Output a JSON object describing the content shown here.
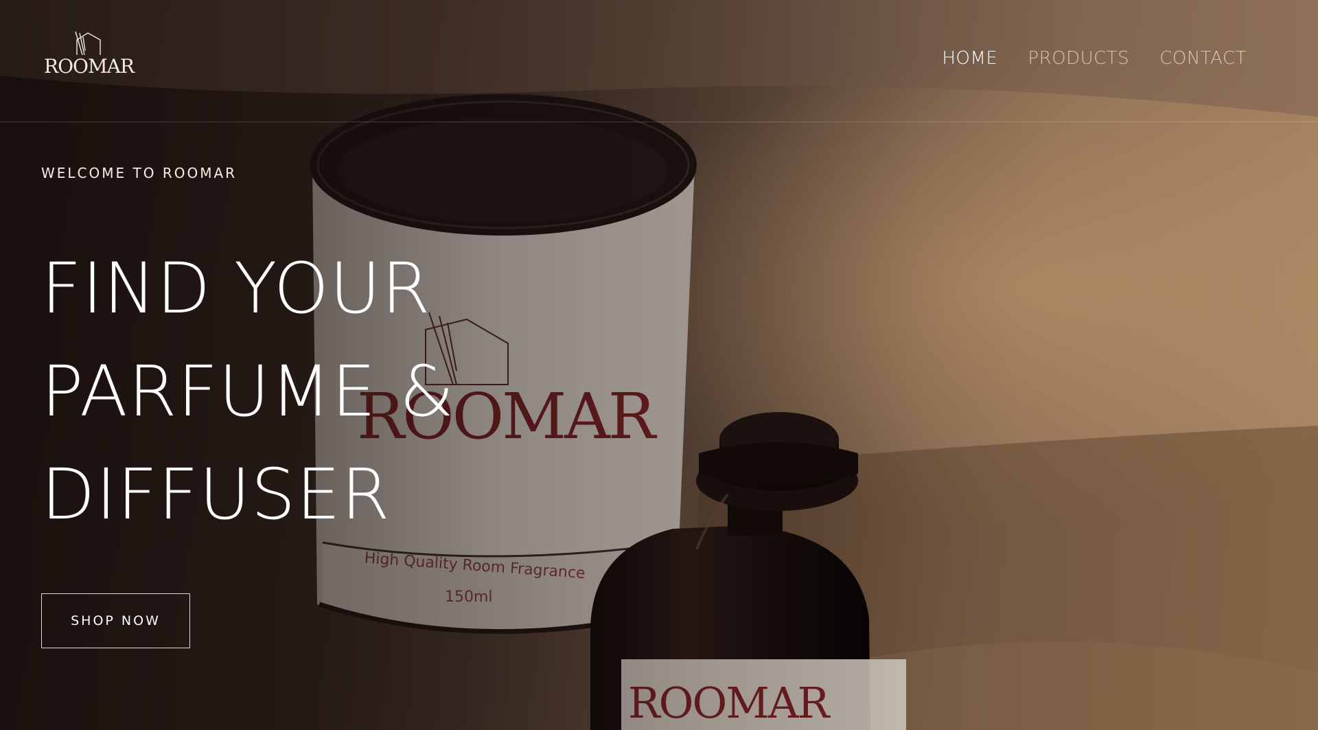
{
  "brand": {
    "name": "ROOMAR",
    "logo_icon": "house-with-reeds-icon"
  },
  "nav": {
    "items": [
      {
        "label": "HOME",
        "active": true
      },
      {
        "label": "PRODUCTS",
        "active": false
      },
      {
        "label": "CONTACT",
        "active": false
      }
    ]
  },
  "hero": {
    "eyebrow": "WELCOME TO ROOMAR",
    "headline_lines": [
      "FIND YOUR",
      "PARFUME &",
      "DIFFUSER"
    ],
    "cta_label": "SHOP NOW"
  },
  "product_image": {
    "box_brand": "ROOMAR",
    "box_caption": "High Quality Room Fragrance",
    "box_volume": "150ml",
    "bottle_brand": "ROOMAR"
  },
  "colors": {
    "text": "#ffffff",
    "nav_inactive": "#c9c0b6",
    "background_dark": "#241713",
    "background_warm": "#a88563",
    "brand_accent": "#7a1f23"
  }
}
